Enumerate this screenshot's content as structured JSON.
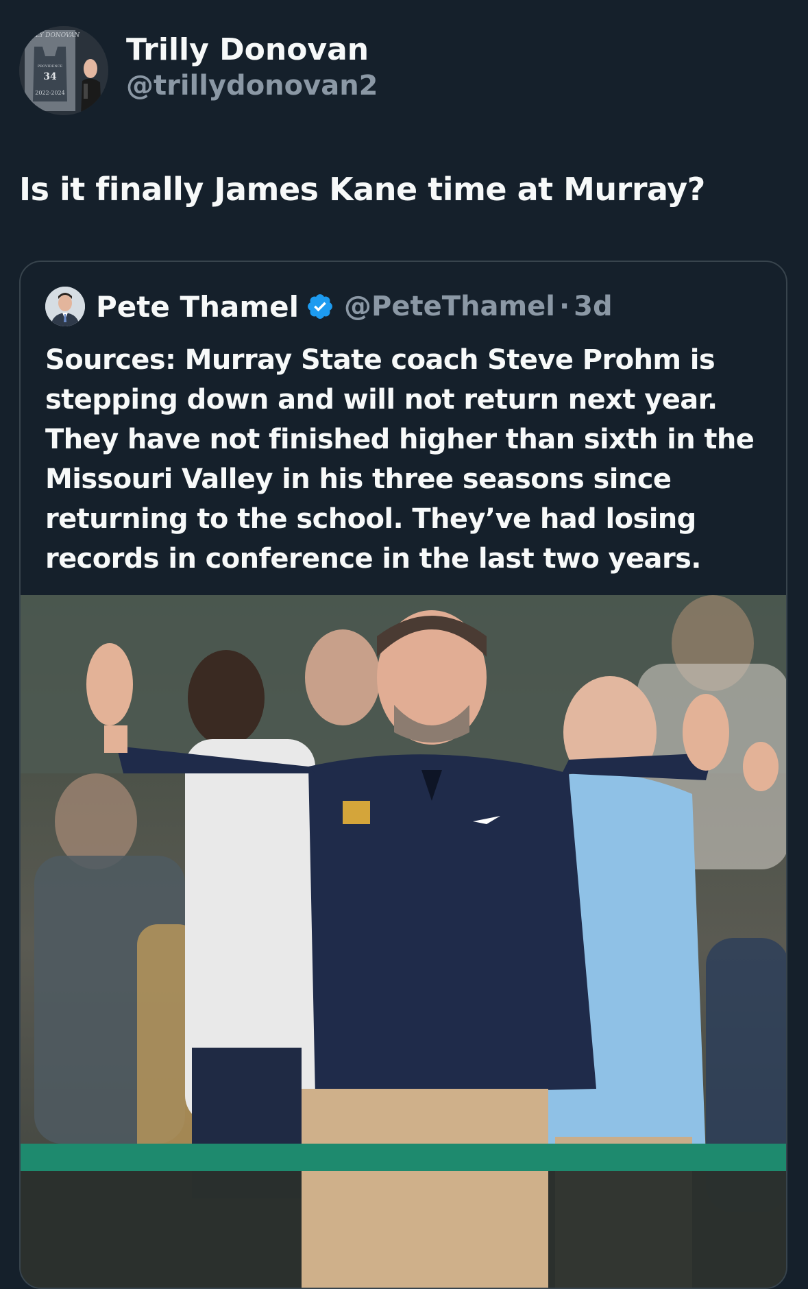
{
  "tweet": {
    "author": {
      "display_name": "Trilly Donovan",
      "handle": "@trillydonovan2",
      "avatar_jersey": {
        "name": "TRILLY DONOVAN",
        "team": "PROVIDENCE",
        "number": "34",
        "years": "2022-2024"
      }
    },
    "text": "Is it finally James Kane time at Murray?"
  },
  "quoted_tweet": {
    "author": {
      "display_name": "Pete Thamel",
      "handle": "@PeteThamel",
      "verified": true
    },
    "separator": "·",
    "time": "3d",
    "text": "Sources: Murray State coach Steve Prohm is stepping down and will not return next year. They have not finished higher than sixth in the Missouri Valley in his three seasons since returning to the school. They’ve had losing records in conference in the last two years."
  },
  "colors": {
    "background": "#15202b",
    "text_primary": "#f7f9f9",
    "text_secondary": "#8b98a5",
    "border": "#38444d",
    "verified": "#1d9bf0"
  }
}
